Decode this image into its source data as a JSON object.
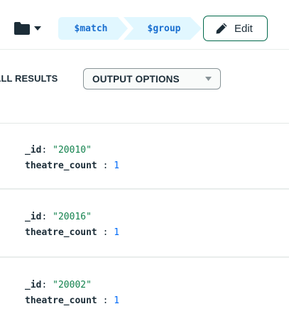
{
  "toolbar": {
    "folder_icon": "folder-icon",
    "caret_icon": "caret-down-icon",
    "stages": [
      {
        "label": "$match"
      },
      {
        "label": "$group"
      }
    ],
    "edit_label": "Edit",
    "edit_icon": "pencil-icon"
  },
  "results": {
    "label": "ALL RESULTS",
    "output_options_label": "OUTPUT OPTIONS"
  },
  "documents": [
    {
      "id_key": "_id",
      "id_value": "\"20010\"",
      "count_key": "theatre_count",
      "count_value": "1"
    },
    {
      "id_key": "_id",
      "id_value": "\"20016\"",
      "count_key": "theatre_count",
      "count_value": "1"
    },
    {
      "id_key": "_id",
      "id_value": "\"20002\"",
      "count_key": "theatre_count",
      "count_value": "1"
    }
  ],
  "colors": {
    "stage_fill": "#e1f7ff",
    "stage_text": "#1a6fd0",
    "accent_green": "#00684a",
    "string_green": "#12824d",
    "number_blue": "#016bf8"
  }
}
